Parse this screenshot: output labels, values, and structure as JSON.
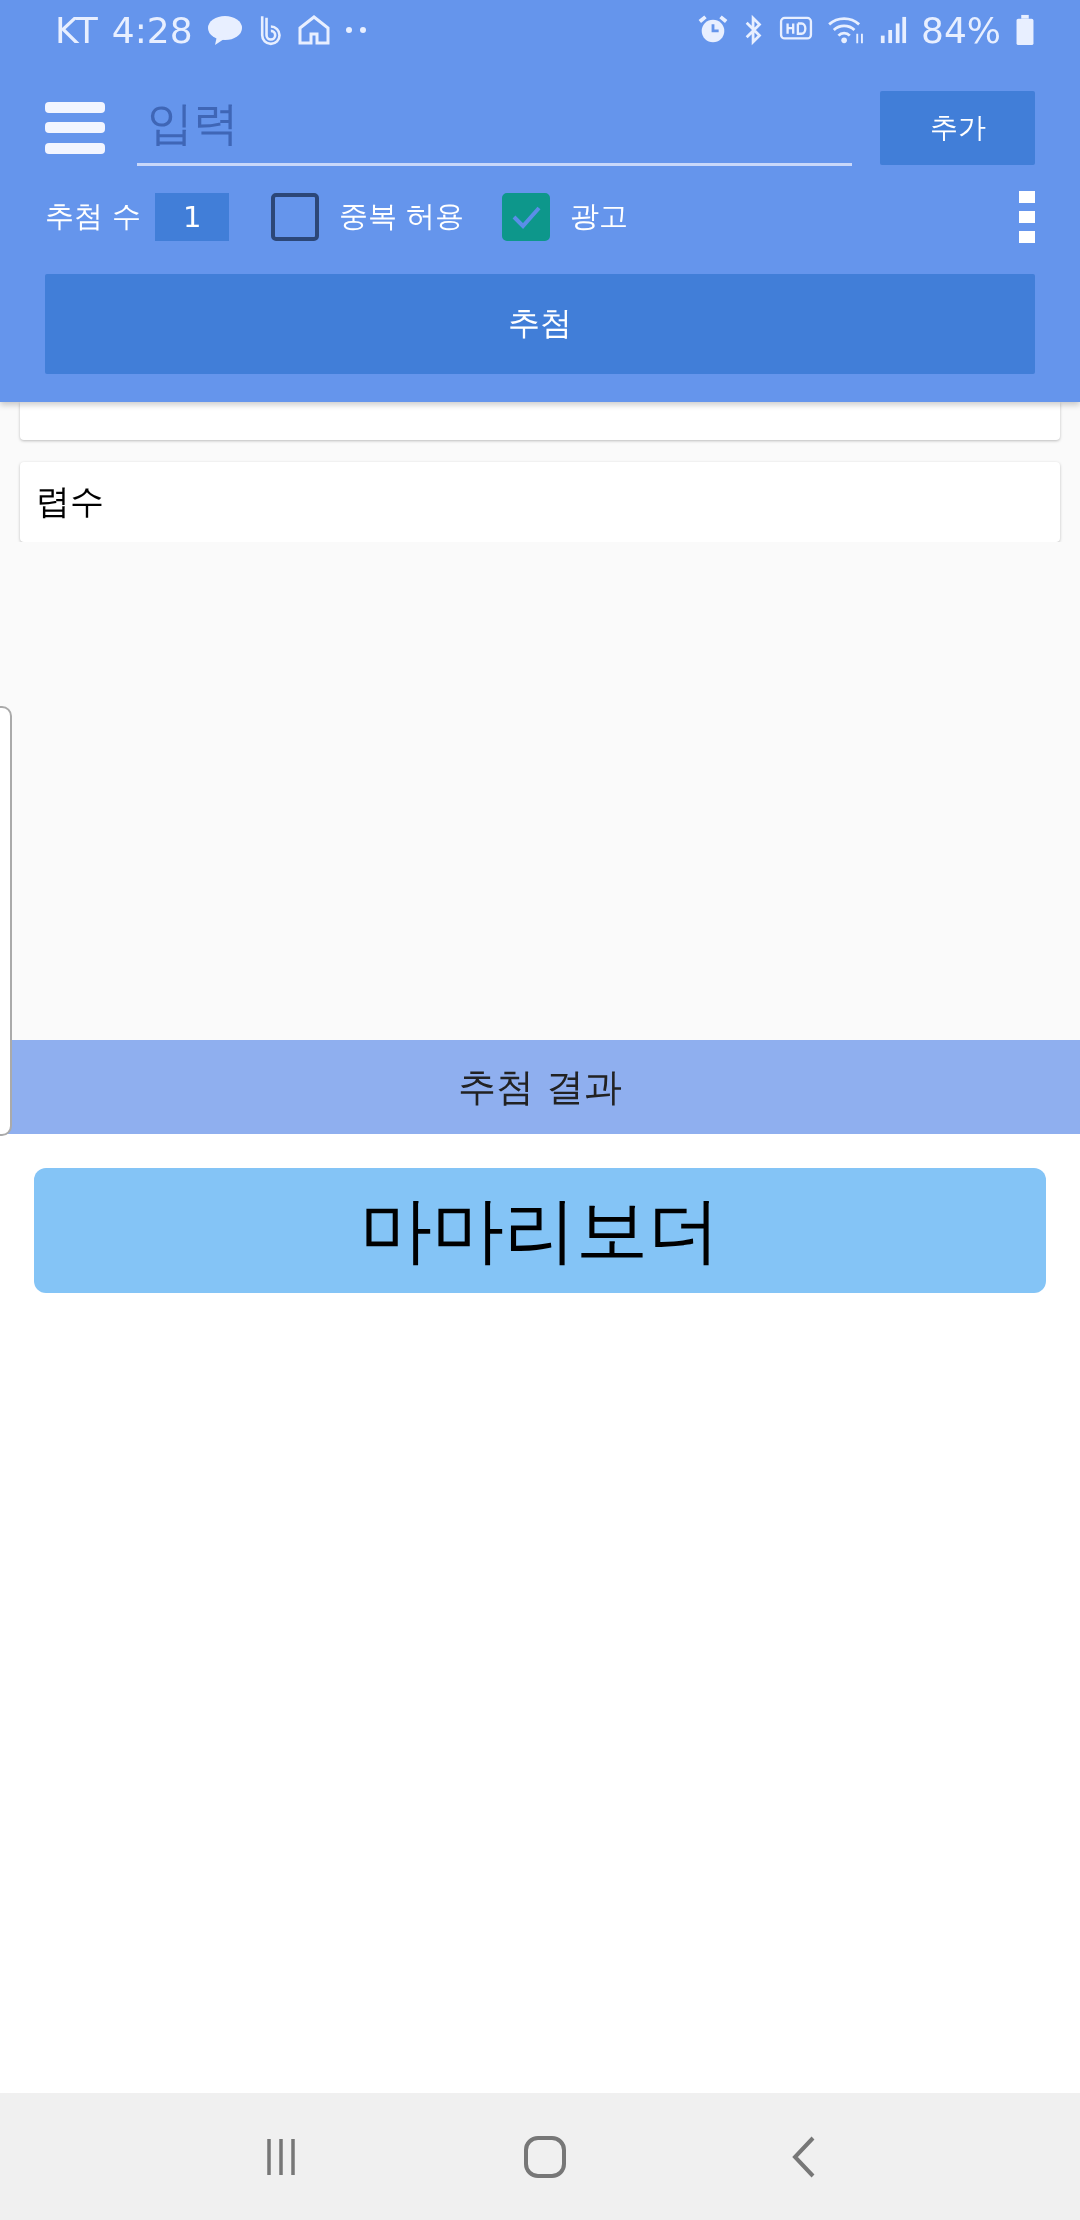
{
  "status_bar": {
    "carrier": "KT",
    "time": "4:28",
    "battery_percent": "84%"
  },
  "toolbar": {
    "input": {
      "placeholder": "입력"
    },
    "add_button": "추가"
  },
  "options": {
    "count_label": "추첨 수",
    "count_value": "1",
    "checkboxes": [
      {
        "label": "중복 허용",
        "checked": false
      },
      {
        "label": "광고",
        "checked": true
      }
    ]
  },
  "draw_button": "추첨",
  "items": [
    {
      "label": "렵수"
    }
  ],
  "result": {
    "title": "추첨 결과",
    "winners": [
      "마마리보더"
    ]
  }
}
